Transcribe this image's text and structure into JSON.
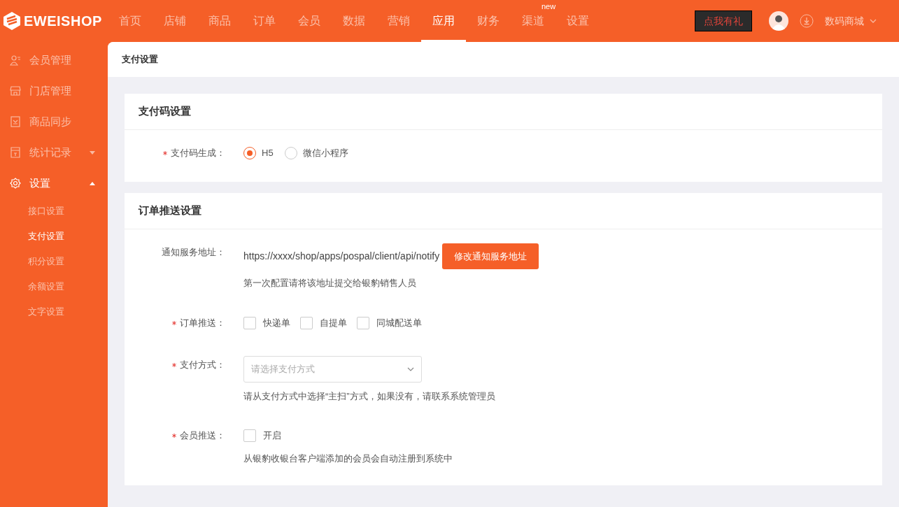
{
  "header": {
    "logo": "EWEISHOP",
    "nav": [
      {
        "label": "首页",
        "selected": false
      },
      {
        "label": "店铺",
        "selected": false
      },
      {
        "label": "商品",
        "selected": false
      },
      {
        "label": "订单",
        "selected": false
      },
      {
        "label": "会员",
        "selected": false
      },
      {
        "label": "数据",
        "selected": false
      },
      {
        "label": "营销",
        "selected": false
      },
      {
        "label": "应用",
        "selected": true
      },
      {
        "label": "财务",
        "selected": false
      },
      {
        "label": "渠道",
        "selected": false,
        "badge": "new"
      },
      {
        "label": "设置",
        "selected": false
      }
    ],
    "gift_button": "点我有礼",
    "shop_name": "数码商城"
  },
  "sidebar": {
    "items": [
      {
        "label": "会员管理",
        "selected": false
      },
      {
        "label": "门店管理",
        "selected": false
      },
      {
        "label": "商品同步",
        "selected": false
      },
      {
        "label": "统计记录",
        "expanded": false,
        "selected": false
      },
      {
        "label": "设置",
        "expanded": true,
        "selected": true,
        "children": [
          {
            "label": "接口设置",
            "selected": false
          },
          {
            "label": "支付设置",
            "selected": true
          },
          {
            "label": "积分设置",
            "selected": false
          },
          {
            "label": "余额设置",
            "selected": false
          },
          {
            "label": "文字设置",
            "selected": false
          }
        ]
      }
    ]
  },
  "page_title": "支付设置",
  "sections": [
    {
      "title": "支付码设置",
      "fields": [
        {
          "kind": "radio",
          "label": "支付码生成：",
          "required": true,
          "options": [
            {
              "label": "H5",
              "selected": true
            },
            {
              "label": "微信小程序",
              "selected": false
            }
          ]
        }
      ]
    },
    {
      "title": "订单推送设置",
      "fields": [
        {
          "kind": "url",
          "label": "通知服务地址：",
          "value": "https://xxxx/shop/apps/pospal/client/api/notify",
          "button": "修改通知服务地址",
          "help": "第一次配置请将该地址提交给银豹销售人员"
        },
        {
          "kind": "checkbox",
          "label": "订单推送：",
          "required": true,
          "options": [
            {
              "label": "快递单",
              "checked": false
            },
            {
              "label": "自提单",
              "checked": false
            },
            {
              "label": "同城配送单",
              "checked": false
            }
          ]
        },
        {
          "kind": "select",
          "label": "支付方式：",
          "required": true,
          "placeholder": "请选择支付方式",
          "help": "请从支付方式中选择“主扫”方式，如果没有，请联系系统管理员"
        },
        {
          "kind": "checkbox",
          "label": "会员推送：",
          "required": true,
          "options": [
            {
              "label": "开启",
              "checked": false
            }
          ],
          "help": "从银豹收银台客户端添加的会员会自动注册到系统中"
        }
      ]
    }
  ]
}
